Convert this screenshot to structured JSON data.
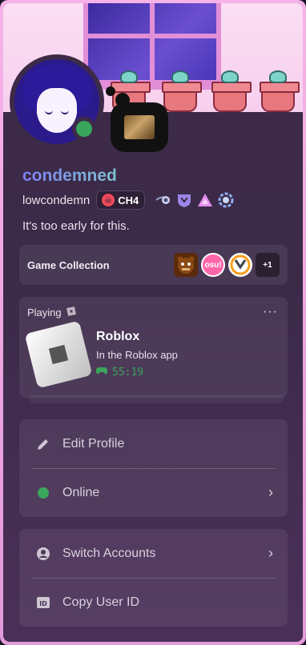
{
  "profile": {
    "display_name": "condemned",
    "username": "lowcondemn",
    "guild_tag": "CH4",
    "bio": "It's too early for this.",
    "status": "online",
    "status_color": "#3aa55d",
    "display_name_gradient": [
      "#7d7ff2",
      "#7fc0cf"
    ]
  },
  "badges": [
    "hypesquad-orb-icon",
    "shield-badge-icon",
    "triangle-badge-icon",
    "nitro-ring-icon"
  ],
  "game_collection": {
    "label": "Game Collection",
    "icons": [
      "fnaf-icon",
      "osu-icon",
      "overwatch-icon"
    ],
    "osu_text": "osu!",
    "more_count": "+1"
  },
  "activity": {
    "header": "Playing",
    "game": "Roblox",
    "detail": "In the Roblox app",
    "elapsed": "55:19",
    "more": "···"
  },
  "menu": {
    "edit_profile": "Edit Profile",
    "online": "Online",
    "switch_accounts": "Switch Accounts",
    "copy_user_id": "Copy User ID"
  }
}
